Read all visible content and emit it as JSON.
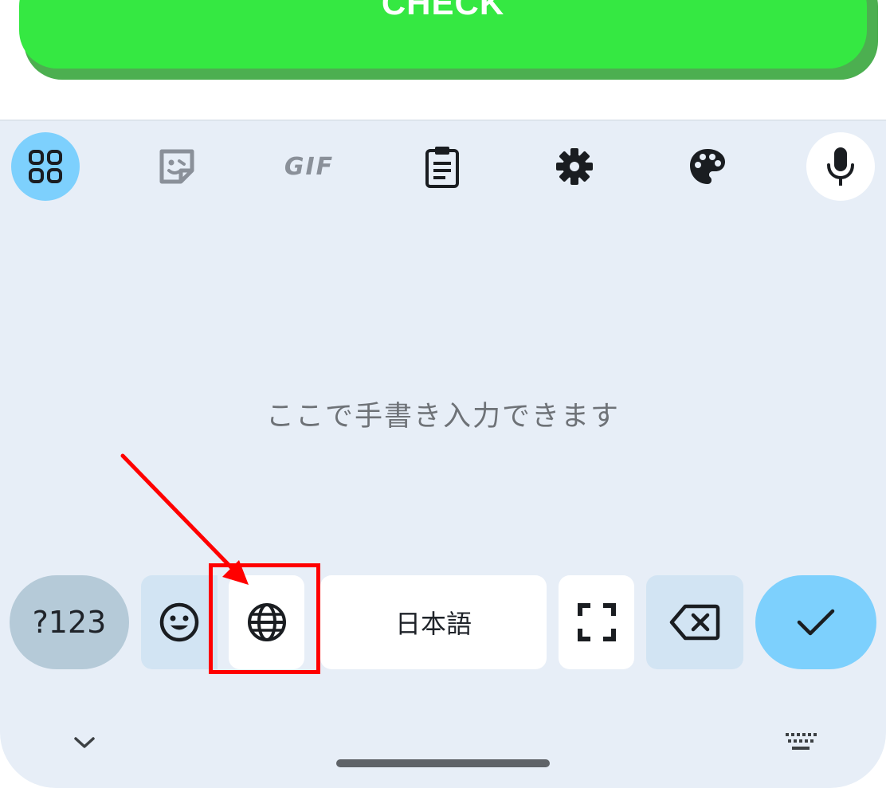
{
  "check_button": {
    "label": "CHECK",
    "color": "#35e842",
    "shadow_color": "#4caf50"
  },
  "toolbar": {
    "items": [
      {
        "name": "apps",
        "icon": "grid-apps-icon",
        "active": true
      },
      {
        "name": "stickers",
        "icon": "sticker-icon"
      },
      {
        "name": "gif",
        "label": "GIF"
      },
      {
        "name": "clipboard",
        "icon": "clipboard-icon"
      },
      {
        "name": "settings",
        "icon": "gear-icon"
      },
      {
        "name": "themes",
        "icon": "palette-icon"
      },
      {
        "name": "voice",
        "icon": "microphone-icon"
      }
    ]
  },
  "handwriting": {
    "placeholder": "ここで手書き入力できます"
  },
  "keys": {
    "symbols_label": "?123",
    "emoji_icon": "smiley-icon",
    "language_icon": "globe-icon",
    "space_label": "日本語",
    "expand_icon": "fullscreen-icon",
    "delete_icon": "backspace-icon",
    "enter_icon": "checkmark-icon"
  },
  "bottom": {
    "collapse_icon": "chevron-down-icon",
    "switch_icon": "keyboard-icon"
  },
  "colors": {
    "keyboard_bg": "#e7eef7",
    "accent": "#7dd0fd",
    "annotation": "#ff0000"
  }
}
